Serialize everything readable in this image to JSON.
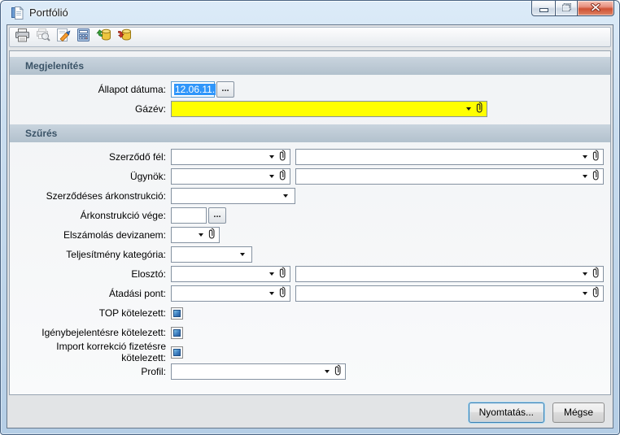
{
  "window": {
    "title": "Portfólió",
    "icon": "document",
    "controls": [
      {
        "name": "minimize"
      },
      {
        "name": "restore"
      },
      {
        "name": "close"
      }
    ]
  },
  "toolbar": {
    "buttons": [
      {
        "icon": "print",
        "enabled": true
      },
      {
        "icon": "print-preview",
        "enabled": false
      },
      {
        "icon": "edit",
        "enabled": true
      },
      {
        "icon": "table-calculator",
        "enabled": true
      },
      {
        "icon": "database-import",
        "enabled": true
      },
      {
        "icon": "database-export",
        "enabled": true
      }
    ]
  },
  "display": {
    "title": "Megjelenítés",
    "status_date": {
      "label": "Állapot dátuma:",
      "value": "12.06.11.",
      "picker_label": "...",
      "selected": true
    },
    "gas_year": {
      "label": "Gázév:",
      "value": "",
      "highlight_color": "#ffff00"
    }
  },
  "filter": {
    "title": "Szűrés",
    "rows": [
      {
        "label": "Szerződő fél:",
        "value": "",
        "value2": ""
      },
      {
        "label": "Ügynök:",
        "value": "",
        "value2": ""
      },
      {
        "label": "Szerződéses árkonstrukció:",
        "value": ""
      },
      {
        "label": "Árkonstrukció vége:",
        "value": "",
        "picker_label": "..."
      },
      {
        "label": "Elszámolás devizanem:",
        "value": ""
      },
      {
        "label": "Teljesítmény kategória:",
        "value": ""
      },
      {
        "label": "Elosztó:",
        "value": "",
        "value2": ""
      },
      {
        "label": "Átadási pont:",
        "value": "",
        "value2": ""
      },
      {
        "label": "TOP kötelezett:",
        "state": "checked"
      },
      {
        "label": "Igénybejelentésre kötelezett:",
        "state": "checked"
      },
      {
        "label": "Import korrekció fizetésre kötelezett:",
        "state": "checked"
      },
      {
        "label": "Profil:",
        "value": ""
      }
    ]
  },
  "footer": {
    "print_label": "Nyomtatás...",
    "cancel_label": "Mégse"
  },
  "colors": {
    "highlight_field_bg": "#ffff00",
    "text_selection_bg": "#2f96fa",
    "section_header_bg": "#b9c7d2",
    "section_header_text": "#3a5367",
    "close_button": "#cf5234"
  }
}
